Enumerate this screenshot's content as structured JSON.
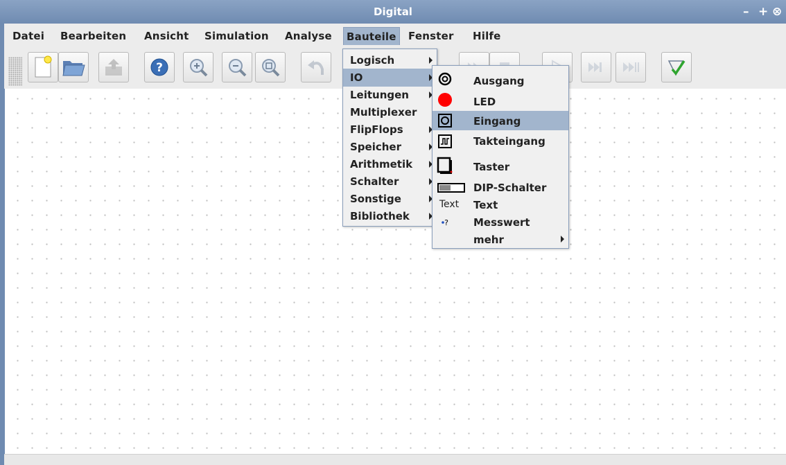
{
  "window": {
    "title": "Digital",
    "controls": [
      "–",
      "+",
      "⊗"
    ]
  },
  "menubar": {
    "items": [
      "Datei",
      "Bearbeiten",
      "Ansicht",
      "Simulation",
      "Analyse",
      "Bauteile",
      "Fenster",
      "Hilfe"
    ],
    "active": "Bauteile"
  },
  "toolbar": {
    "buttons": [
      {
        "name": "new-file-icon",
        "enabled": true
      },
      {
        "name": "open-folder-icon",
        "enabled": true
      },
      {
        "name": "save-icon",
        "enabled": false
      },
      {
        "name": "help-icon",
        "enabled": true
      },
      {
        "name": "zoom-in-icon",
        "enabled": true
      },
      {
        "name": "zoom-out-icon",
        "enabled": true
      },
      {
        "name": "zoom-fit-icon",
        "enabled": true
      },
      {
        "name": "undo-icon",
        "enabled": false
      },
      {
        "name": "play-icon",
        "enabled": false
      },
      {
        "name": "step-icon",
        "enabled": false
      },
      {
        "name": "step-fast-icon",
        "enabled": false
      },
      {
        "name": "analyse-check-icon",
        "enabled": true
      }
    ]
  },
  "bauteile_menu": {
    "items": [
      {
        "label": "Logisch",
        "submenu": true
      },
      {
        "label": "IO",
        "submenu": true,
        "highlighted": true
      },
      {
        "label": "Leitungen",
        "submenu": true
      },
      {
        "label": "Multiplexer",
        "submenu": true
      },
      {
        "label": "FlipFlops",
        "submenu": true
      },
      {
        "label": "Speicher",
        "submenu": true
      },
      {
        "label": "Arithmetik",
        "submenu": true
      },
      {
        "label": "Schalter",
        "submenu": true
      },
      {
        "label": "Sonstige",
        "submenu": true
      },
      {
        "label": "Bibliothek",
        "submenu": true
      }
    ]
  },
  "io_submenu": {
    "items": [
      {
        "label": "Ausgang",
        "icon": "output-ring-icon"
      },
      {
        "label": "LED",
        "icon": "led-icon"
      },
      {
        "label": "Eingang",
        "icon": "input-box-icon",
        "highlighted": true
      },
      {
        "label": "Takteingang",
        "icon": "clock-input-icon"
      },
      {
        "label": "Taster",
        "icon": "button-icon"
      },
      {
        "label": "DIP-Schalter",
        "icon": "dip-switch-icon"
      },
      {
        "label": "Text",
        "icon": "text-icon",
        "icon_text": "Text"
      },
      {
        "label": "Messwert",
        "icon": "probe-icon",
        "icon_text": "?"
      },
      {
        "label": "mehr",
        "submenu": true
      }
    ]
  },
  "colors": {
    "titlebar": "#7b96bb",
    "highlight": "#a2b5cd",
    "led": "#ff0000"
  }
}
